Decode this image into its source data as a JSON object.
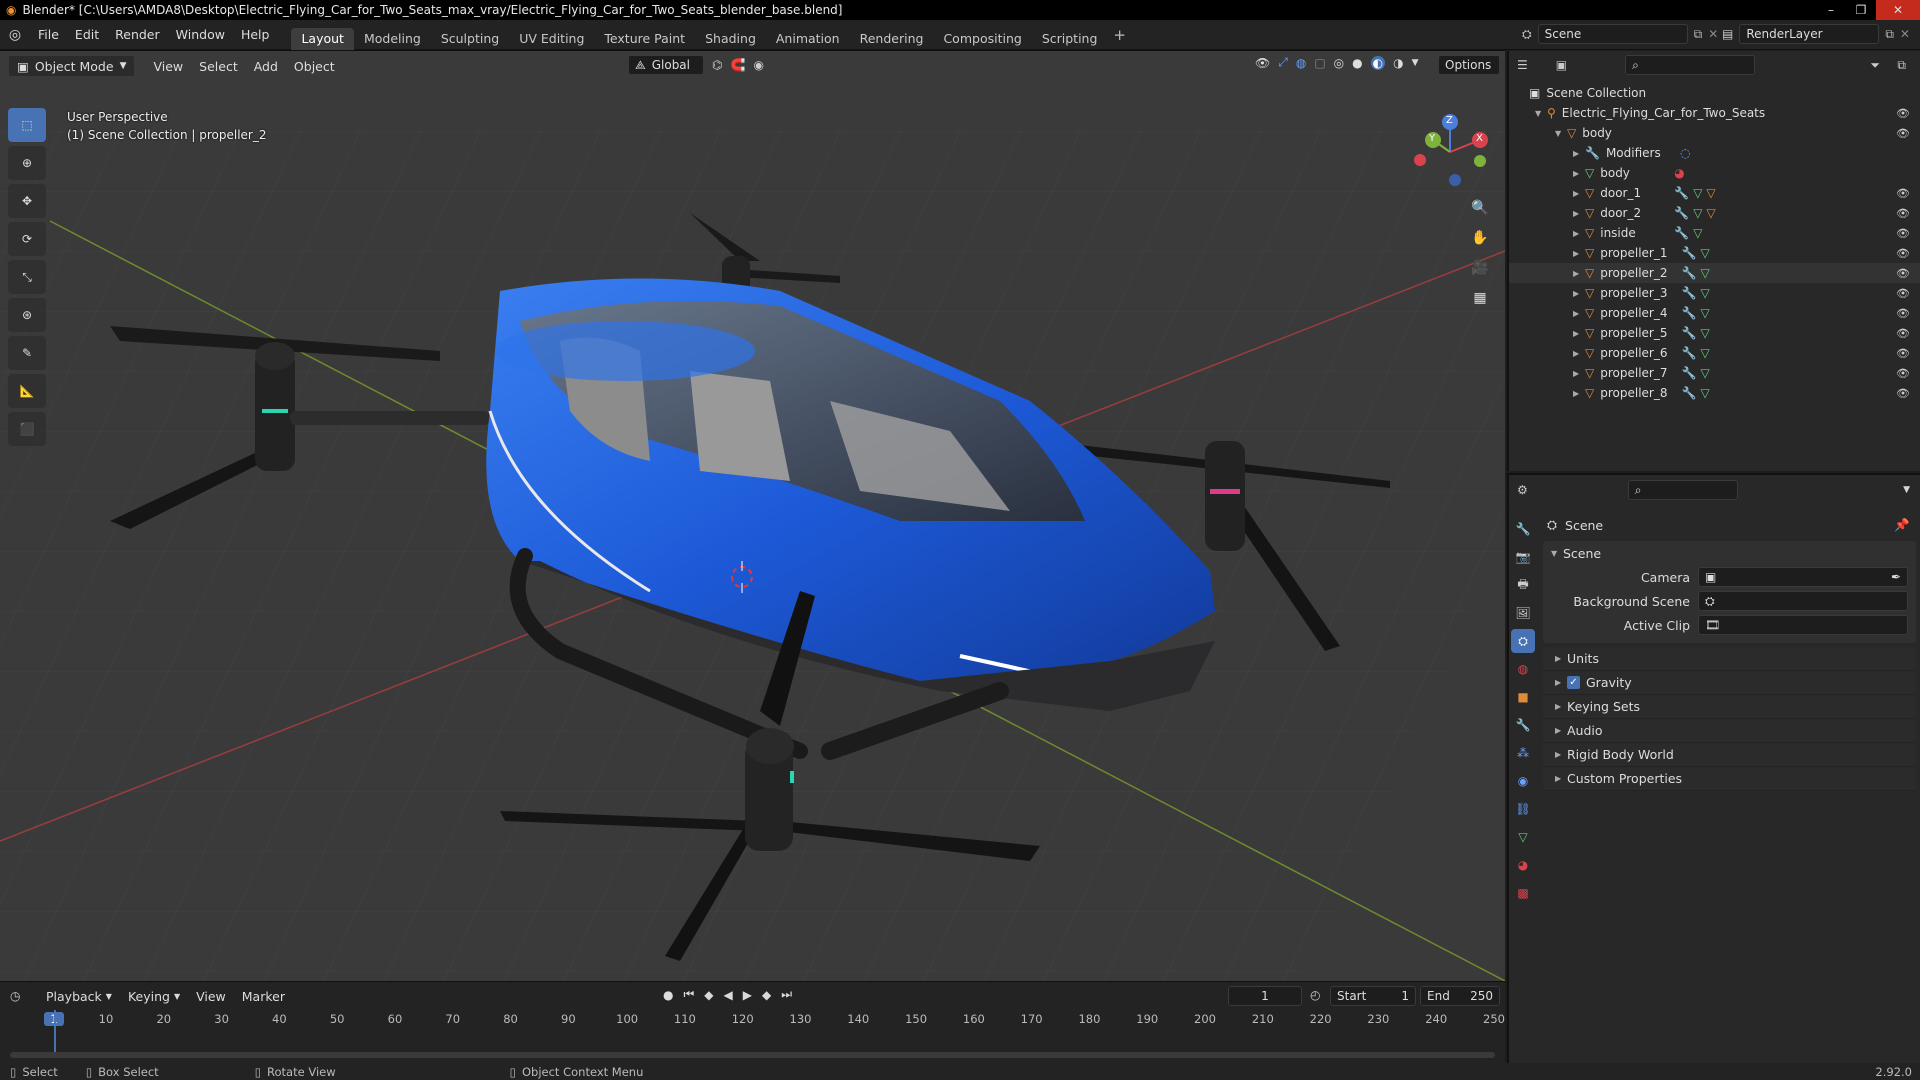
{
  "window": {
    "title": "Blender* [C:\\Users\\AMDA8\\Desktop\\Electric_Flying_Car_for_Two_Seats_max_vray/Electric_Flying_Car_for_Two_Seats_blender_base.blend]",
    "min": "–",
    "max": "❐",
    "close": "✕"
  },
  "menu": [
    "File",
    "Edit",
    "Render",
    "Window",
    "Help"
  ],
  "workspaces": [
    "Layout",
    "Modeling",
    "Sculpting",
    "UV Editing",
    "Texture Paint",
    "Shading",
    "Animation",
    "Rendering",
    "Compositing",
    "Scripting"
  ],
  "active_workspace": "Layout",
  "add_workspace": "+",
  "scene_field": "Scene",
  "renderlayer_field": "RenderLayer",
  "toolheader": {
    "orientation": "Global",
    "options": "Options"
  },
  "viewport": {
    "mode": "Object Mode",
    "menus": [
      "View",
      "Select",
      "Add",
      "Object"
    ],
    "overlay_line1": "User Perspective",
    "overlay_line2": "(1) Scene Collection | propeller_2",
    "gizmo": {
      "x": "X",
      "y": "Y",
      "z": "Z"
    }
  },
  "timeline": {
    "menus": [
      "Playback",
      "Keying",
      "View",
      "Marker"
    ],
    "current_frame": "1",
    "start_label": "Start",
    "start_value": "1",
    "end_label": "End",
    "end_value": "250",
    "ticks": [
      "1",
      "10",
      "20",
      "30",
      "40",
      "50",
      "60",
      "70",
      "80",
      "90",
      "100",
      "110",
      "120",
      "130",
      "140",
      "150",
      "160",
      "170",
      "180",
      "190",
      "200",
      "210",
      "220",
      "230",
      "240",
      "250"
    ]
  },
  "statusbar": {
    "select": "Select",
    "box_select": "Box Select",
    "rotate_view": "Rotate View",
    "context_menu": "Object Context Menu",
    "version": "2.92.0"
  },
  "outliner": {
    "root": "Scene Collection",
    "collection": "Electric_Flying_Car_for_Two_Seats",
    "body": "body",
    "body_children": [
      {
        "name": "Modifiers",
        "type": "modifier"
      },
      {
        "name": "body",
        "type": "mesh"
      },
      {
        "name": "door_1",
        "type": "object"
      },
      {
        "name": "door_2",
        "type": "object"
      },
      {
        "name": "inside",
        "type": "object"
      },
      {
        "name": "propeller_1",
        "type": "object"
      },
      {
        "name": "propeller_2",
        "type": "object"
      },
      {
        "name": "propeller_3",
        "type": "object"
      },
      {
        "name": "propeller_4",
        "type": "object"
      },
      {
        "name": "propeller_5",
        "type": "object"
      },
      {
        "name": "propeller_6",
        "type": "object"
      },
      {
        "name": "propeller_7",
        "type": "object"
      },
      {
        "name": "propeller_8",
        "type": "object"
      }
    ]
  },
  "properties": {
    "context": "Scene",
    "panel": "Scene",
    "camera_label": "Camera",
    "background_label": "Background Scene",
    "clip_label": "Active Clip",
    "sections": [
      "Units",
      "Gravity",
      "Keying Sets",
      "Audio",
      "Rigid Body World",
      "Custom Properties"
    ]
  },
  "colors": {
    "accent": "#4772b3",
    "object_orange": "#e08a3a",
    "mesh_green": "#5fcf7a",
    "body_blue": "#1f5fd6"
  }
}
